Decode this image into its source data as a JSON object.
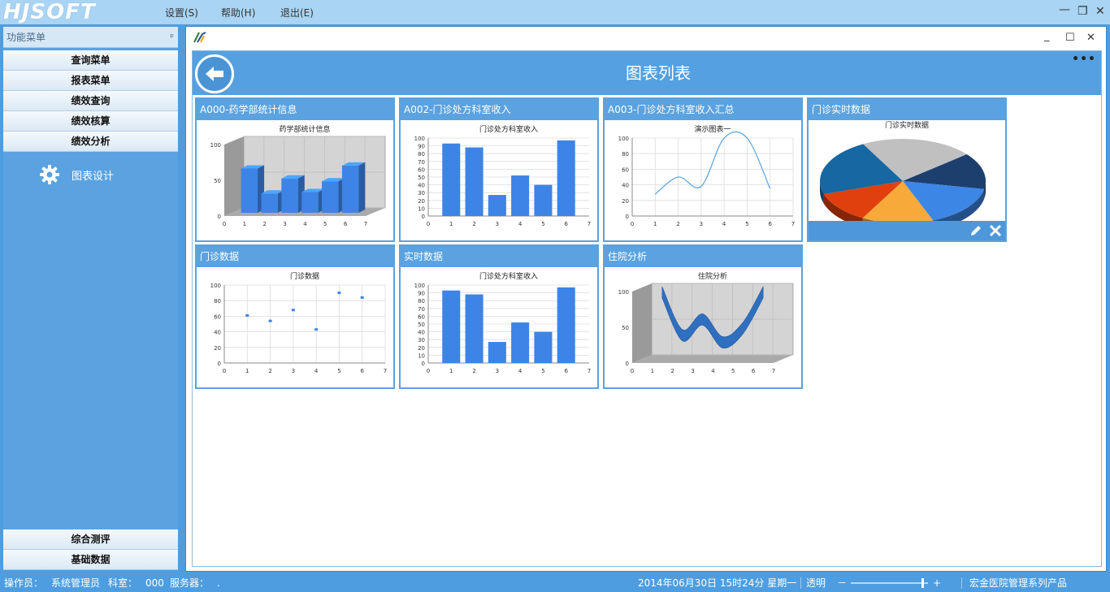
{
  "app": {
    "logo_text": "HJSOFT",
    "menu": [
      "设置(S)",
      "帮助(H)",
      "退出(E)"
    ]
  },
  "sidebar": {
    "header": "功能菜单",
    "buttons": [
      "查询菜单",
      "报表菜单",
      "绩效查询",
      "绩效核算",
      "绩效分析"
    ],
    "active_item": "图表设计",
    "bottom_buttons": [
      "综合测评",
      "基础数据"
    ]
  },
  "main": {
    "title": "图表列表"
  },
  "cards": [
    {
      "title": "A000-药学部统计信息"
    },
    {
      "title": "A002-门诊处方科室收入"
    },
    {
      "title": "A003-门诊处方科室收入汇总"
    },
    {
      "title": "门诊实时数据"
    },
    {
      "title": "门诊数据"
    },
    {
      "title": "实时数据"
    },
    {
      "title": "住院分析"
    }
  ],
  "chart_data": [
    {
      "type": "bar",
      "title": "药学部统计信息",
      "x": [
        1,
        2,
        3,
        4,
        5,
        6
      ],
      "values": [
        62,
        27,
        48,
        29,
        44,
        66
      ],
      "ylim": [
        0,
        100
      ],
      "yticks": [
        0,
        50,
        100
      ],
      "xlim": [
        0,
        7
      ],
      "view": "3d",
      "color": "#3d84e6"
    },
    {
      "type": "bar",
      "title": "门诊处方科室收入",
      "x": [
        1,
        2,
        3,
        4,
        5,
        6
      ],
      "values": [
        93,
        88,
        27,
        52,
        40,
        97
      ],
      "ylim": [
        0,
        100
      ],
      "yticks": [
        0,
        10,
        20,
        30,
        40,
        50,
        60,
        70,
        80,
        90,
        100
      ],
      "xlim": [
        0,
        7
      ],
      "color": "#3d84e6"
    },
    {
      "type": "line",
      "title": "演示图表一",
      "x": [
        1,
        2,
        3,
        4,
        5,
        6
      ],
      "values": [
        28,
        50,
        38,
        100,
        100,
        35
      ],
      "ylim": [
        0,
        100
      ],
      "yticks": [
        0,
        20,
        40,
        60,
        80,
        100
      ],
      "xlim": [
        0,
        7
      ],
      "smooth": true,
      "color": "#5aa2e0"
    },
    {
      "type": "pie",
      "title": "门诊实时数据",
      "values": [
        22,
        14,
        16,
        14,
        12,
        22
      ],
      "colors": [
        "#c0c0c0",
        "#1d3f6e",
        "#3c86e6",
        "#f7a93a",
        "#e0400e",
        "#1767a3"
      ],
      "view": "3d"
    },
    {
      "type": "scatter",
      "title": "门诊数据",
      "x": [
        1,
        2,
        3,
        4,
        5,
        6
      ],
      "values": [
        61,
        54,
        68,
        43,
        90,
        84
      ],
      "ylim": [
        0,
        100
      ],
      "yticks": [
        0,
        20,
        40,
        60,
        80,
        100
      ],
      "xlim": [
        0,
        7
      ],
      "color": "#3d84e6"
    },
    {
      "type": "bar",
      "title": "门诊处方科室收入",
      "x": [
        1,
        2,
        3,
        4,
        5,
        6
      ],
      "values": [
        93,
        88,
        27,
        52,
        40,
        97
      ],
      "ylim": [
        0,
        100
      ],
      "yticks": [
        0,
        10,
        20,
        30,
        40,
        50,
        60,
        70,
        80,
        90,
        100
      ],
      "xlim": [
        0,
        7
      ],
      "color": "#3d84e6"
    },
    {
      "type": "area",
      "title": "住院分析",
      "x": [
        1,
        2,
        3,
        4,
        5,
        6
      ],
      "values": [
        100,
        40,
        62,
        30,
        50,
        100
      ],
      "ylim": [
        0,
        100
      ],
      "yticks": [
        0,
        50,
        100
      ],
      "xlim": [
        0,
        7
      ],
      "view": "3d",
      "color": "#2f6fbf"
    }
  ],
  "statusbar": {
    "operator_label": "操作员：",
    "operator": "系统管理员",
    "dept_label": "科室：",
    "dept": "000",
    "server_label": "服务器：",
    "server": ".",
    "datetime": "2014年06月30日 15时24分 星期一",
    "transparency_label": "透明",
    "transparency_minus": "－",
    "transparency_plus": "+",
    "transparency_level": 0.95,
    "product": "宏金医院管理系列产品"
  }
}
